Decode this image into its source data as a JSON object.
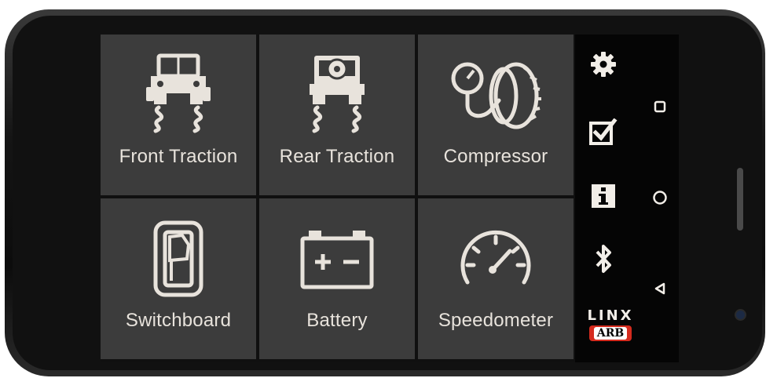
{
  "tiles": [
    {
      "label": "Front Traction",
      "icon": "front-traction-icon"
    },
    {
      "label": "Rear Traction",
      "icon": "rear-traction-icon"
    },
    {
      "label": "Compressor",
      "icon": "compressor-icon"
    },
    {
      "label": "Switchboard",
      "icon": "switch-icon"
    },
    {
      "label": "Battery",
      "icon": "battery-icon"
    },
    {
      "label": "Speedometer",
      "icon": "speedometer-icon"
    }
  ],
  "sidebar": {
    "icons": [
      "gear-icon",
      "checkbox-icon",
      "info-icon",
      "bluetooth-icon"
    ],
    "nav": [
      "recent-apps-icon",
      "home-icon",
      "back-icon"
    ]
  },
  "logo": {
    "top": "LINX",
    "badge": "ARB"
  },
  "colors": {
    "tile": "#3c3c3c",
    "icon": "#e8e3dc",
    "brand_red": "#d52b1e"
  }
}
